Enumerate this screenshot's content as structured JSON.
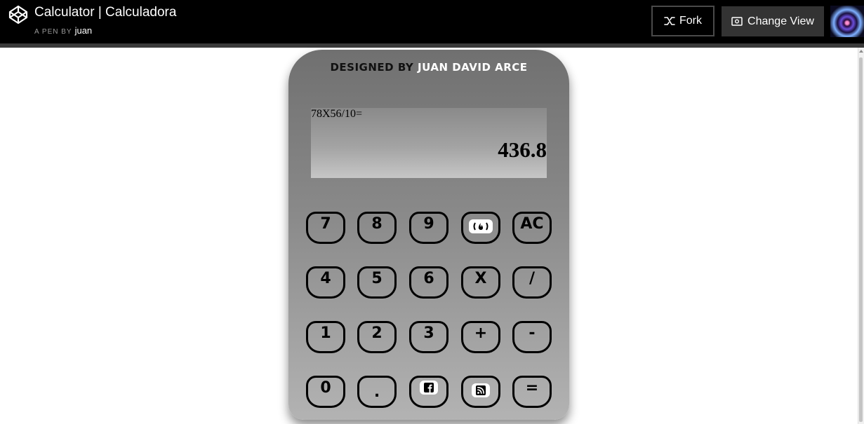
{
  "header": {
    "title": "Calculator | Calculadora",
    "byline_prefix": "A PEN BY",
    "author": "juan",
    "fork_label": "Fork",
    "change_view_label": "Change View"
  },
  "calculator": {
    "designed_prefix": "Designed by",
    "designer": "Juan David Arce",
    "expression": "78X56/10=",
    "result": "436.8",
    "keys": [
      {
        "label": "7"
      },
      {
        "label": "8"
      },
      {
        "label": "9"
      },
      {
        "label": "",
        "icon": "freecodecamp-icon"
      },
      {
        "label": "AC"
      },
      {
        "label": "4"
      },
      {
        "label": "5"
      },
      {
        "label": "6"
      },
      {
        "label": "X"
      },
      {
        "label": "/"
      },
      {
        "label": "1"
      },
      {
        "label": "2"
      },
      {
        "label": "3"
      },
      {
        "label": "+"
      },
      {
        "label": "-"
      },
      {
        "label": "0"
      },
      {
        "label": "."
      },
      {
        "label": "",
        "icon": "facebook-icon"
      },
      {
        "label": "",
        "icon": "rss-icon"
      },
      {
        "label": "="
      }
    ]
  },
  "colors": {
    "header_bg": "#000000",
    "calc_top": "#707070",
    "calc_bottom": "#b3b3b3"
  }
}
